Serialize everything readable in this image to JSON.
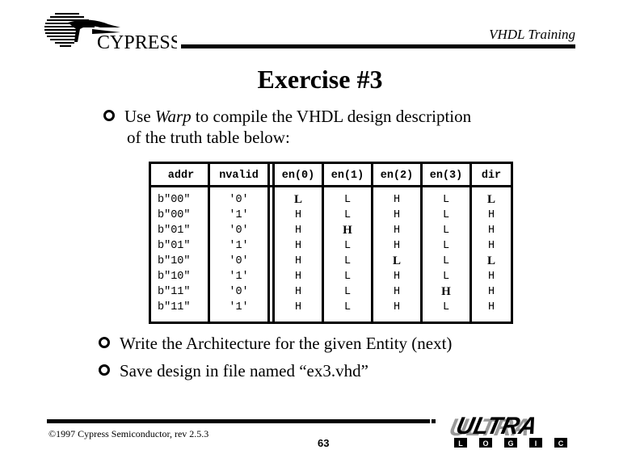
{
  "header": {
    "logo_text": "CYPRESS",
    "title": "VHDL Training"
  },
  "slide": {
    "title": "Exercise #3",
    "bullets": [
      {
        "pre": "Use ",
        "em": "Warp",
        "post": " to compile the VHDL design description",
        "line2": "of the truth table below:"
      },
      {
        "text": "Write the Architecture for the given Entity (next)"
      },
      {
        "text": "Save design in file named “ex3.vhd”"
      }
    ],
    "bullet_icon": "hollow-circle-bullet-icon"
  },
  "truth_table": {
    "headers": [
      "addr",
      "nvalid",
      "en(0)",
      "en(1)",
      "en(2)",
      "en(3)",
      "dir"
    ],
    "rows": [
      {
        "addr": "b\"00\"",
        "nvalid": "'0'",
        "en0": "L",
        "en1": "L",
        "en2": "H",
        "en3": "L",
        "dir": "L"
      },
      {
        "addr": "b\"00\"",
        "nvalid": "'1'",
        "en0": "H",
        "en1": "L",
        "en2": "H",
        "en3": "L",
        "dir": "H"
      },
      {
        "addr": "b\"01\"",
        "nvalid": "'0'",
        "en0": "H",
        "en1": "H",
        "en2": "H",
        "en3": "L",
        "dir": "H"
      },
      {
        "addr": "b\"01\"",
        "nvalid": "'1'",
        "en0": "H",
        "en1": "L",
        "en2": "H",
        "en3": "L",
        "dir": "H"
      },
      {
        "addr": "b\"10\"",
        "nvalid": "'0'",
        "en0": "H",
        "en1": "L",
        "en2": "L",
        "en3": "L",
        "dir": "L"
      },
      {
        "addr": "b\"10\"",
        "nvalid": "'1'",
        "en0": "H",
        "en1": "L",
        "en2": "H",
        "en3": "L",
        "dir": "H"
      },
      {
        "addr": "b\"11\"",
        "nvalid": "'0'",
        "en0": "H",
        "en1": "L",
        "en2": "H",
        "en3": "H",
        "dir": "H"
      },
      {
        "addr": "b\"11\"",
        "nvalid": "'1'",
        "en0": "H",
        "en1": "L",
        "en2": "H",
        "en3": "L",
        "dir": "H"
      }
    ]
  },
  "footer": {
    "copyright": "©1997 Cypress Semiconductor, rev 2.5.3",
    "page_number": "63",
    "logo_text": "ULTRA",
    "logo_subtext": [
      "L",
      "O",
      "G",
      "I",
      "C"
    ]
  }
}
